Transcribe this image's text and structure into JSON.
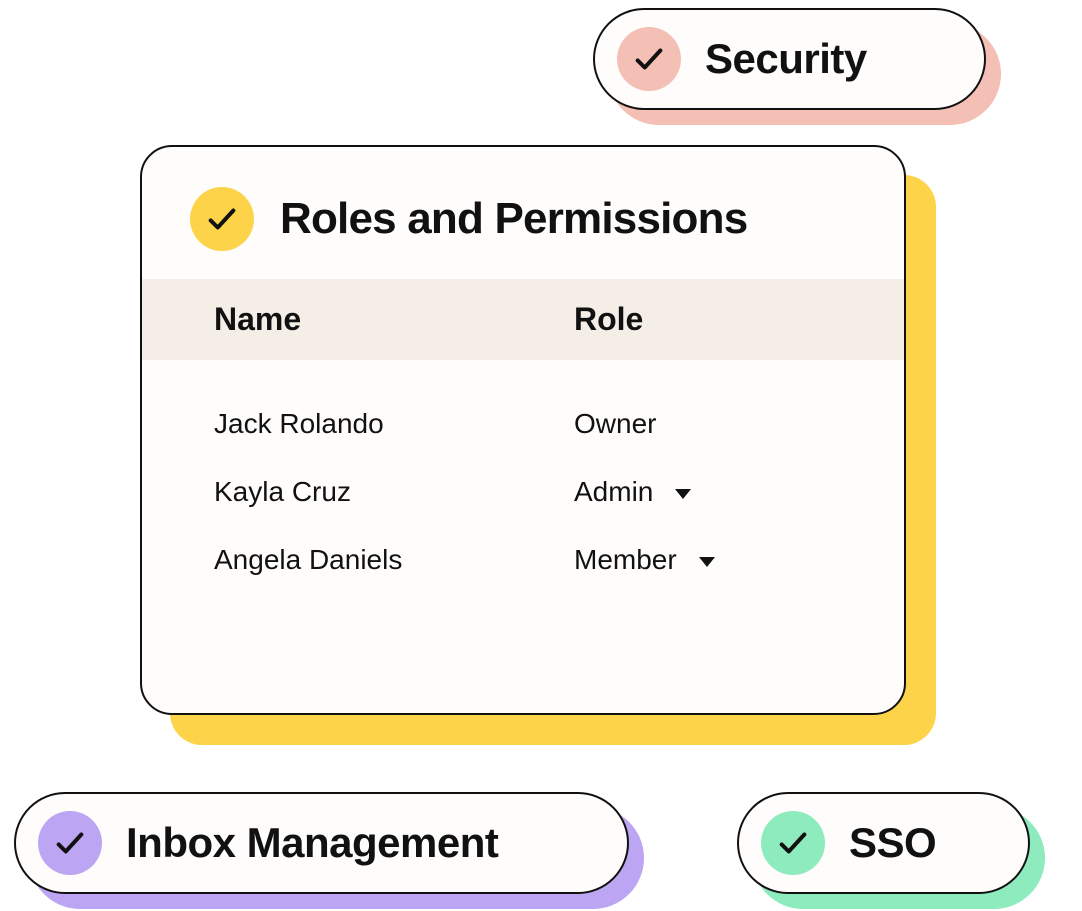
{
  "pills": {
    "security": {
      "label": "Security"
    },
    "inbox": {
      "label": "Inbox Management"
    },
    "sso": {
      "label": "SSO"
    }
  },
  "card": {
    "title": "Roles and Permissions",
    "columns": {
      "name": "Name",
      "role": "Role"
    },
    "rows": [
      {
        "name": "Jack Rolando",
        "role": "Owner",
        "editable": false
      },
      {
        "name": "Kayla Cruz",
        "role": "Admin",
        "editable": true
      },
      {
        "name": "Angela Daniels",
        "role": "Member",
        "editable": true
      }
    ]
  }
}
